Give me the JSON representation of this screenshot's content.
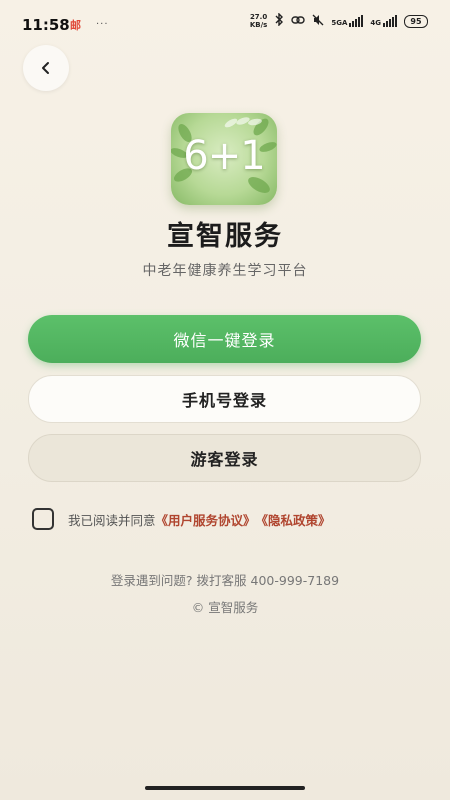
{
  "status_bar": {
    "time": "11:58",
    "app_badge": "邮",
    "dots": "···",
    "net_speed_value": "27.0",
    "net_speed_unit": "KB/s",
    "network_label": "5GA",
    "lte_label": "4G",
    "battery": "95"
  },
  "header": {
    "back_icon": "chevron-left-icon"
  },
  "app": {
    "logo_text": "6+1",
    "title": "宣智服务",
    "subtitle": "中老年健康养生学习平台"
  },
  "buttons": {
    "wechat_login": "微信一键登录",
    "phone_login": "手机号登录",
    "guest_login": "游客登录"
  },
  "agreement": {
    "prefix": "我已阅读并同意",
    "user_agreement": "《用户服务协议》",
    "privacy_policy": "《隐私政策》"
  },
  "footer": {
    "help": "登录遇到问题? 拨打客服 400-999-7189",
    "copyright": "© 宣智服务"
  },
  "colors": {
    "primary_green": "#4cae5b",
    "link_red": "#b0452f",
    "background": "#f3eee3"
  }
}
